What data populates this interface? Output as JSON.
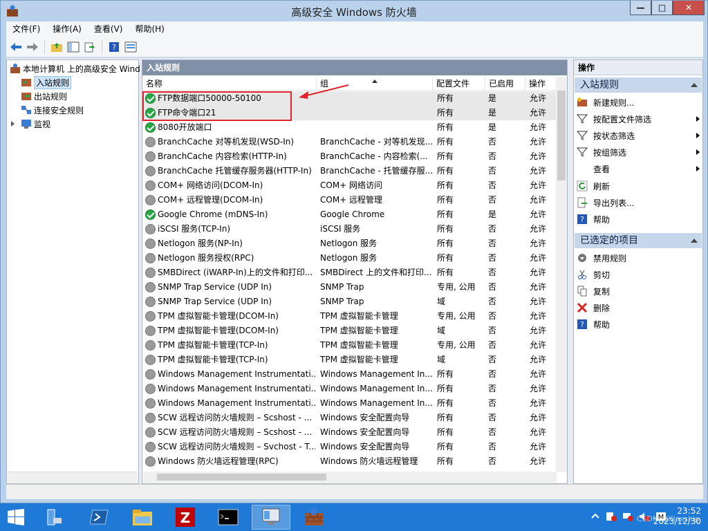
{
  "window": {
    "title": "高级安全 Windows 防火墙",
    "controls": {
      "minimize": "—",
      "maximize": "□",
      "close": "✕"
    }
  },
  "menu": [
    "文件(F)",
    "操作(A)",
    "查看(V)",
    "帮助(H)"
  ],
  "tree": {
    "root": "本地计算机 上的高级安全 Wind",
    "items": [
      "入站规则",
      "出站规则",
      "连接安全规则",
      "监视"
    ]
  },
  "middle": {
    "header": "入站规则",
    "columns": {
      "name": "名称",
      "group": "组",
      "profile": "配置文件",
      "enabled": "已启用",
      "action": "操作"
    },
    "rows": [
      {
        "name": "FTP数据端口50000-50100",
        "group": "",
        "profile": "所有",
        "enabled": "是",
        "action": "允许",
        "on": true
      },
      {
        "name": "FTP命令端口21",
        "group": "",
        "profile": "所有",
        "enabled": "是",
        "action": "允许",
        "on": true
      },
      {
        "name": "8080开放端口",
        "group": "",
        "profile": "所有",
        "enabled": "是",
        "action": "允许",
        "on": true
      },
      {
        "name": "BranchCache 对等机发现(WSD-In)",
        "group": "BranchCache - 对等机发现...",
        "profile": "所有",
        "enabled": "否",
        "action": "允许",
        "on": false
      },
      {
        "name": "BranchCache 内容检索(HTTP-In)",
        "group": "BranchCache - 内容检索(...",
        "profile": "所有",
        "enabled": "否",
        "action": "允许",
        "on": false
      },
      {
        "name": "BranchCache 托管缓存服务器(HTTP-In)",
        "group": "BranchCache - 托管缓存服...",
        "profile": "所有",
        "enabled": "否",
        "action": "允许",
        "on": false
      },
      {
        "name": "COM+ 网络访问(DCOM-In)",
        "group": "COM+ 网络访问",
        "profile": "所有",
        "enabled": "否",
        "action": "允许",
        "on": false
      },
      {
        "name": "COM+ 远程管理(DCOM-In)",
        "group": "COM+ 远程管理",
        "profile": "所有",
        "enabled": "否",
        "action": "允许",
        "on": false
      },
      {
        "name": "Google Chrome (mDNS-In)",
        "group": "Google Chrome",
        "profile": "所有",
        "enabled": "是",
        "action": "允许",
        "on": true
      },
      {
        "name": "iSCSI 服务(TCP-In)",
        "group": "iSCSI 服务",
        "profile": "所有",
        "enabled": "否",
        "action": "允许",
        "on": false
      },
      {
        "name": "Netlogon 服务(NP-In)",
        "group": "Netlogon 服务",
        "profile": "所有",
        "enabled": "否",
        "action": "允许",
        "on": false
      },
      {
        "name": "Netlogon 服务授权(RPC)",
        "group": "Netlogon 服务",
        "profile": "所有",
        "enabled": "否",
        "action": "允许",
        "on": false
      },
      {
        "name": "SMBDirect (iWARP-In)上的文件和打印...",
        "group": "SMBDirect 上的文件和打印...",
        "profile": "所有",
        "enabled": "否",
        "action": "允许",
        "on": false
      },
      {
        "name": "SNMP Trap Service (UDP In)",
        "group": "SNMP Trap",
        "profile": "专用, 公用",
        "enabled": "否",
        "action": "允许",
        "on": false
      },
      {
        "name": "SNMP Trap Service (UDP In)",
        "group": "SNMP Trap",
        "profile": "域",
        "enabled": "否",
        "action": "允许",
        "on": false
      },
      {
        "name": "TPM 虚拟智能卡管理(DCOM-In)",
        "group": "TPM 虚拟智能卡管理",
        "profile": "专用, 公用",
        "enabled": "否",
        "action": "允许",
        "on": false
      },
      {
        "name": "TPM 虚拟智能卡管理(DCOM-In)",
        "group": "TPM 虚拟智能卡管理",
        "profile": "域",
        "enabled": "否",
        "action": "允许",
        "on": false
      },
      {
        "name": "TPM 虚拟智能卡管理(TCP-In)",
        "group": "TPM 虚拟智能卡管理",
        "profile": "专用, 公用",
        "enabled": "否",
        "action": "允许",
        "on": false
      },
      {
        "name": "TPM 虚拟智能卡管理(TCP-In)",
        "group": "TPM 虚拟智能卡管理",
        "profile": "域",
        "enabled": "否",
        "action": "允许",
        "on": false
      },
      {
        "name": "Windows Management Instrumentati...",
        "group": "Windows Management In...",
        "profile": "所有",
        "enabled": "否",
        "action": "允许",
        "on": false
      },
      {
        "name": "Windows Management Instrumentati...",
        "group": "Windows Management In...",
        "profile": "所有",
        "enabled": "否",
        "action": "允许",
        "on": false
      },
      {
        "name": "Windows Management Instrumentati...",
        "group": "Windows Management In...",
        "profile": "所有",
        "enabled": "否",
        "action": "允许",
        "on": false
      },
      {
        "name": "SCW 远程访问防火墙规则 – Scshost - ...",
        "group": "Windows 安全配置向导",
        "profile": "所有",
        "enabled": "否",
        "action": "允许",
        "on": false
      },
      {
        "name": "SCW 远程访问防火墙规则 – Scshost - ...",
        "group": "Windows 安全配置向导",
        "profile": "所有",
        "enabled": "否",
        "action": "允许",
        "on": false
      },
      {
        "name": "SCW 远程访问防火墙规则 – Svchost - T...",
        "group": "Windows 安全配置向导",
        "profile": "所有",
        "enabled": "否",
        "action": "允许",
        "on": false
      },
      {
        "name": "Windows 防火墙远程管理(RPC)",
        "group": "Windows 防火墙远程管理",
        "profile": "所有",
        "enabled": "否",
        "action": "允许",
        "on": false
      }
    ]
  },
  "actions": {
    "header": "操作",
    "section1": "入站规则",
    "section1_items": [
      "新建规则...",
      "按配置文件筛选",
      "按状态筛选",
      "按组筛选",
      "查看",
      "刷新",
      "导出列表...",
      "帮助"
    ],
    "section2": "已选定的项目",
    "section2_items": [
      "禁用规则",
      "剪切",
      "复制",
      "删除",
      "帮助"
    ]
  },
  "taskbar": {
    "time": "23:52",
    "date": "2023/12/30",
    "watermark": "CSDN @Klasship"
  }
}
